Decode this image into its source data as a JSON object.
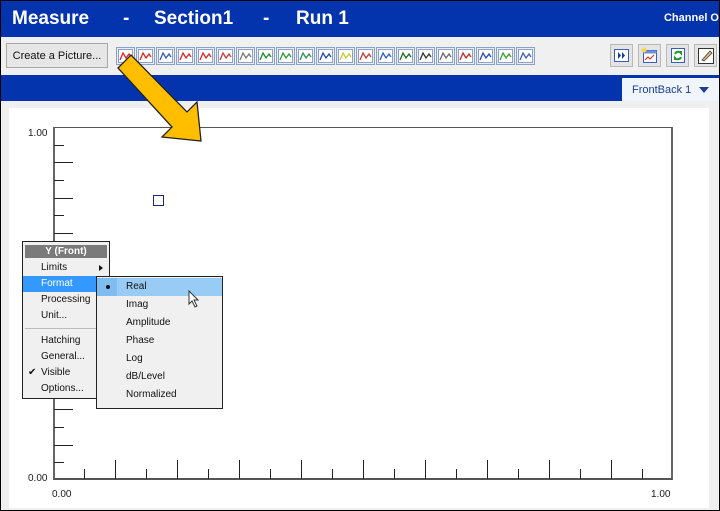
{
  "titlebar": {
    "app": "Measure",
    "sep1": "-",
    "section": "Section1",
    "sep2": "-",
    "run": "Run 1",
    "channel": "Channel O"
  },
  "toolbar": {
    "create_picture_label": "Create a Picture...",
    "icons": [
      "line-chart-icon",
      "double-line-chart-icon",
      "stacked-line-icon",
      "spectrum-icon",
      "nyquist-icon",
      "polar-icon",
      "scatter-3d-icon",
      "bar-chart-icon",
      "colormap-icon",
      "contour-icon",
      "waterfall-icon",
      "list-lines-icon",
      "matrix-colormap-icon",
      "directivity-icon",
      "numeric-display-icon",
      "table-display-icon",
      "film-icon",
      "axes-3d-icon",
      "axes-3d-alt-icon",
      "geometry-icon",
      "target-icon"
    ],
    "right_icons": [
      "play-forward-icon",
      "new-window-chart-icon",
      "refresh-icon",
      "edit-icon"
    ]
  },
  "tab": {
    "label": "FrontBack 1"
  },
  "chart_data": {
    "type": "scatter",
    "title": "",
    "xlabel": "",
    "ylabel": "",
    "xlim": [
      0.0,
      1.0
    ],
    "ylim": [
      0.0,
      1.0
    ],
    "x_tick_labels": [
      "0.00",
      "1.00"
    ],
    "y_tick_labels": [
      "0.00",
      "1.00"
    ],
    "x_minor_ticks": 20,
    "y_minor_ticks": 20,
    "grid": false,
    "points": [
      {
        "x": 0.17,
        "y": 0.79
      }
    ]
  },
  "context_menu": {
    "header": "Y (Front)",
    "items": [
      {
        "label": "Limits",
        "submenu": true
      },
      {
        "label": "Format",
        "submenu": true,
        "highlighted": true
      },
      {
        "label": "Processing"
      },
      {
        "label": "Unit..."
      },
      {
        "label": "Hatching"
      },
      {
        "label": "General..."
      },
      {
        "label": "Visible",
        "checked": true
      },
      {
        "label": "Options..."
      }
    ]
  },
  "format_submenu": {
    "items": [
      {
        "label": "Real",
        "selected": true
      },
      {
        "label": "Imag"
      },
      {
        "label": "Amplitude"
      },
      {
        "label": "Phase"
      },
      {
        "label": "Log"
      },
      {
        "label": "dB/Level"
      },
      {
        "label": "Normalized"
      }
    ]
  },
  "colors": {
    "title_bar": "#0433ae",
    "menu_highlight": "#3399ff",
    "submenu_highlight": "#99ccf5",
    "annotation_arrow": "#ffbf00"
  }
}
